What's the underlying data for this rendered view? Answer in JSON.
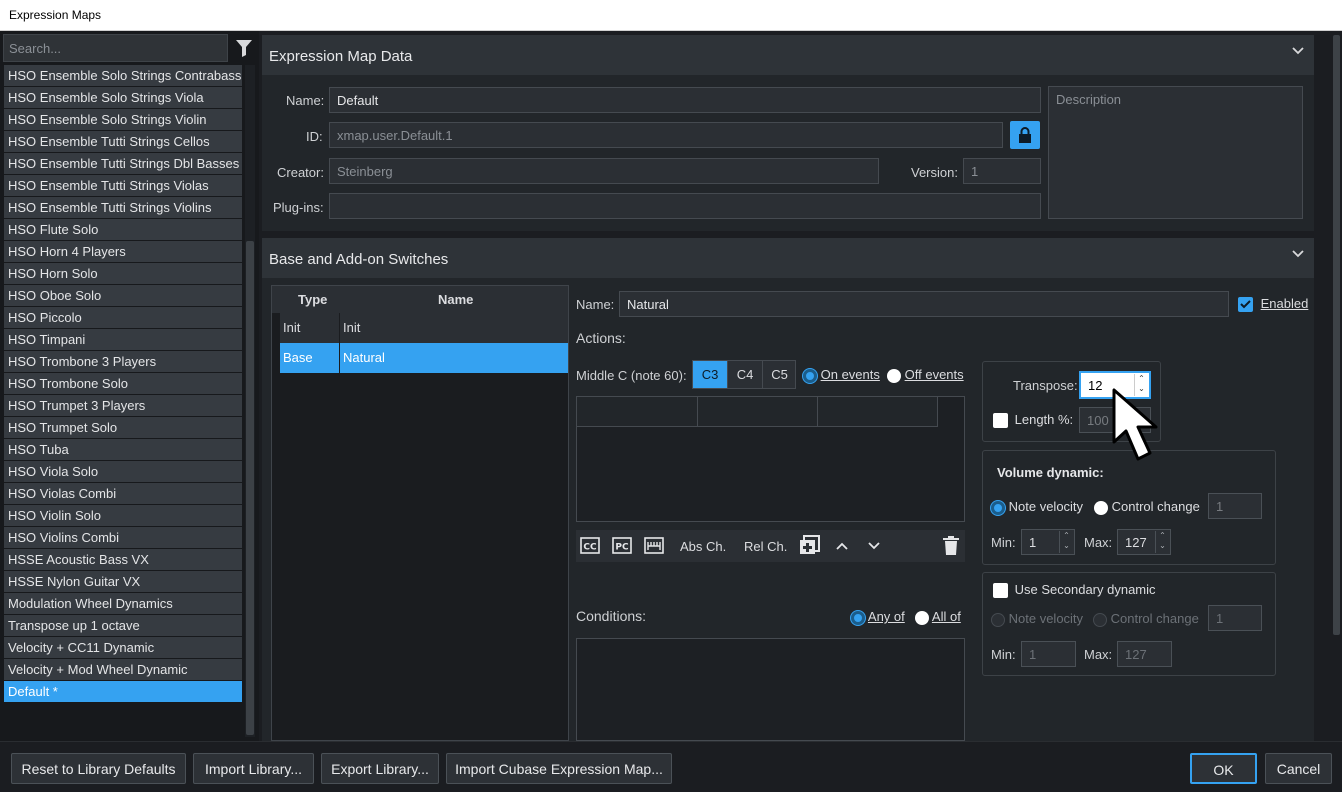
{
  "window": {
    "title": "Expression Maps"
  },
  "sidebar": {
    "search_placeholder": "Search...",
    "items": [
      "HSO Ensemble Solo Strings Contrabass",
      "HSO Ensemble Solo Strings Viola",
      "HSO Ensemble Solo Strings Violin",
      "HSO Ensemble Tutti Strings Cellos",
      "HSO Ensemble Tutti Strings Dbl Basses",
      "HSO Ensemble Tutti Strings Violas",
      "HSO Ensemble Tutti Strings Violins",
      "HSO Flute Solo",
      "HSO Horn 4 Players",
      "HSO Horn Solo",
      "HSO Oboe Solo",
      "HSO Piccolo",
      "HSO Timpani",
      "HSO Trombone 3 Players",
      "HSO Trombone Solo",
      "HSO Trumpet 3 Players",
      "HSO Trumpet Solo",
      "HSO Tuba",
      "HSO Viola Solo",
      "HSO Violas Combi",
      "HSO Violin Solo",
      "HSO Violins Combi",
      "HSSE Acoustic Bass VX",
      "HSSE Nylon Guitar VX",
      "Modulation Wheel Dynamics",
      "Transpose up 1 octave",
      "Velocity + CC11 Dynamic",
      "Velocity + Mod Wheel Dynamic",
      "Default *"
    ],
    "selected_index": 28
  },
  "map_data": {
    "heading": "Expression Map Data",
    "name_label": "Name:",
    "name_value": "Default",
    "id_label": "ID:",
    "id_value": "xmap.user.Default.1",
    "creator_label": "Creator:",
    "creator_value": "Steinberg",
    "version_label": "Version:",
    "version_value": "1",
    "plugins_label": "Plug-ins:",
    "plugins_value": "",
    "description_placeholder": "Description"
  },
  "switches": {
    "heading": "Base and Add-on Switches",
    "table_headers": {
      "type": "Type",
      "name": "Name"
    },
    "rows": [
      {
        "type": "Init",
        "name": "Init"
      },
      {
        "type": "Base",
        "name": "Natural"
      }
    ],
    "selected_row": 1,
    "name_label": "Name:",
    "name_value": "Natural",
    "enabled_label": "Enabled",
    "actions_label": "Actions:",
    "middle_c_label": "Middle C (note 60):",
    "middle_c_options": [
      "C3",
      "C4",
      "C5"
    ],
    "middle_c_selected": "C3",
    "on_events": "On events",
    "off_events": "Off events",
    "toolbar": {
      "abs": "Abs Ch.",
      "rel": "Rel Ch."
    },
    "conditions_label": "Conditions:",
    "any_of": "Any of",
    "all_of": "All of",
    "transpose_label": "Transpose:",
    "transpose_value": "12",
    "length_label": "Length %:",
    "length_value": "100",
    "volume_dynamic_label": "Volume dynamic:",
    "note_velocity": "Note velocity",
    "control_change": "Control change",
    "cc_value": "1",
    "min_label": "Min:",
    "max_label": "Max:",
    "min_value": "1",
    "max_value": "127",
    "secondary_label": "Use Secondary dynamic",
    "sec_cc_value": "1",
    "sec_min_value": "1",
    "sec_max_value": "127"
  },
  "footer": {
    "reset": "Reset to Library Defaults",
    "import_lib": "Import Library...",
    "export_lib": "Export Library...",
    "import_cubase": "Import Cubase Expression Map...",
    "ok": "OK",
    "cancel": "Cancel"
  },
  "colors": {
    "accent": "#35a2f1",
    "panel": "#22262a",
    "header": "#2e3338"
  }
}
